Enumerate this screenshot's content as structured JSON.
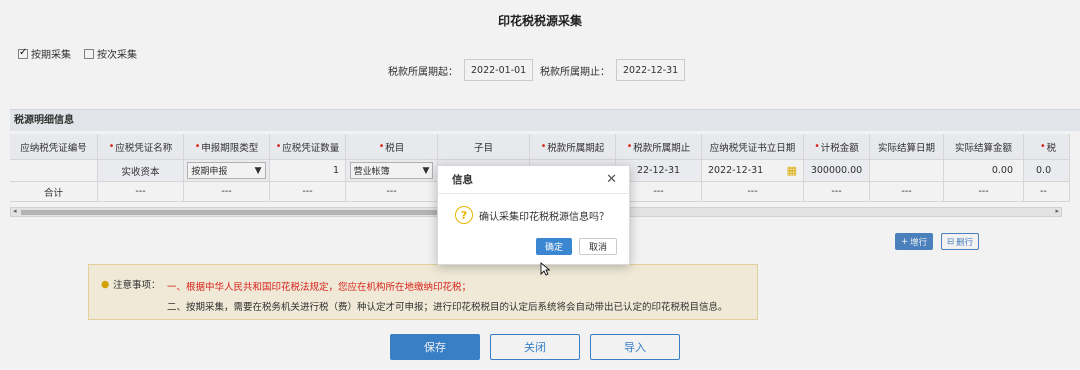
{
  "page": {
    "title": "印花税税源采集"
  },
  "collect_mode": {
    "by_period": {
      "label": "按期采集",
      "checked": true
    },
    "by_item": {
      "label": "按次采集",
      "checked": false
    }
  },
  "period": {
    "start_label": "税款所属期起：",
    "start_value": "2022-01-01",
    "end_label": "税款所属期止：",
    "end_value": "2022-12-31"
  },
  "detail": {
    "title": "税源明细信息",
    "columns": [
      {
        "label": "应纳税凭证编号",
        "required": false
      },
      {
        "label": "应税凭证名称",
        "required": true
      },
      {
        "label": "申报期限类型",
        "required": true
      },
      {
        "label": "应税凭证数量",
        "required": true
      },
      {
        "label": "税目",
        "required": true
      },
      {
        "label": "子目",
        "required": false
      },
      {
        "label": "税款所属期起",
        "required": true
      },
      {
        "label": "税款所属期止",
        "required": true
      },
      {
        "label": "应纳税凭证书立日期",
        "required": false
      },
      {
        "label": "计税金额",
        "required": true
      },
      {
        "label": "实际结算日期",
        "required": false
      },
      {
        "label": "实际结算金额",
        "required": false
      },
      {
        "label": "税",
        "required": true
      }
    ],
    "row": {
      "voucher_no": "",
      "voucher_name": "实收资本",
      "deadline_type": "按期申报",
      "quantity": "1",
      "tax_item": "营业帐簿",
      "sub_item": "",
      "period_start": "",
      "period_end": "22-12-31",
      "issue_date": "2022-12-31",
      "taxable_amount": "300000.00",
      "settle_date": "",
      "settle_amount": "0.00",
      "tax": "0.0"
    },
    "summary": {
      "label": "合计",
      "dash": "---",
      "last": "--"
    }
  },
  "row_actions": {
    "add": "增行",
    "delete": "删行"
  },
  "notice": {
    "label": "注意事项：",
    "line1": "一、根据中华人民共和国印花税法规定，您应在机构所在地缴纳印花税；",
    "line2": "二、按期采集，需要在税务机关进行税（费）种认定才可申报；进行印花税税目的认定后系统将会自动带出已认定的印花税税目信息。"
  },
  "actions": {
    "save": "保存",
    "close": "关闭",
    "import": "导入"
  },
  "dialog": {
    "title": "信息",
    "message": "确认采集印花税税源信息吗？",
    "ok": "确定",
    "cancel": "取消"
  },
  "colors": {
    "accent": "#3b86d1",
    "required": "#e2231a",
    "notice_bg": "#fdf6e3",
    "warn_icon": "#e8b600"
  }
}
